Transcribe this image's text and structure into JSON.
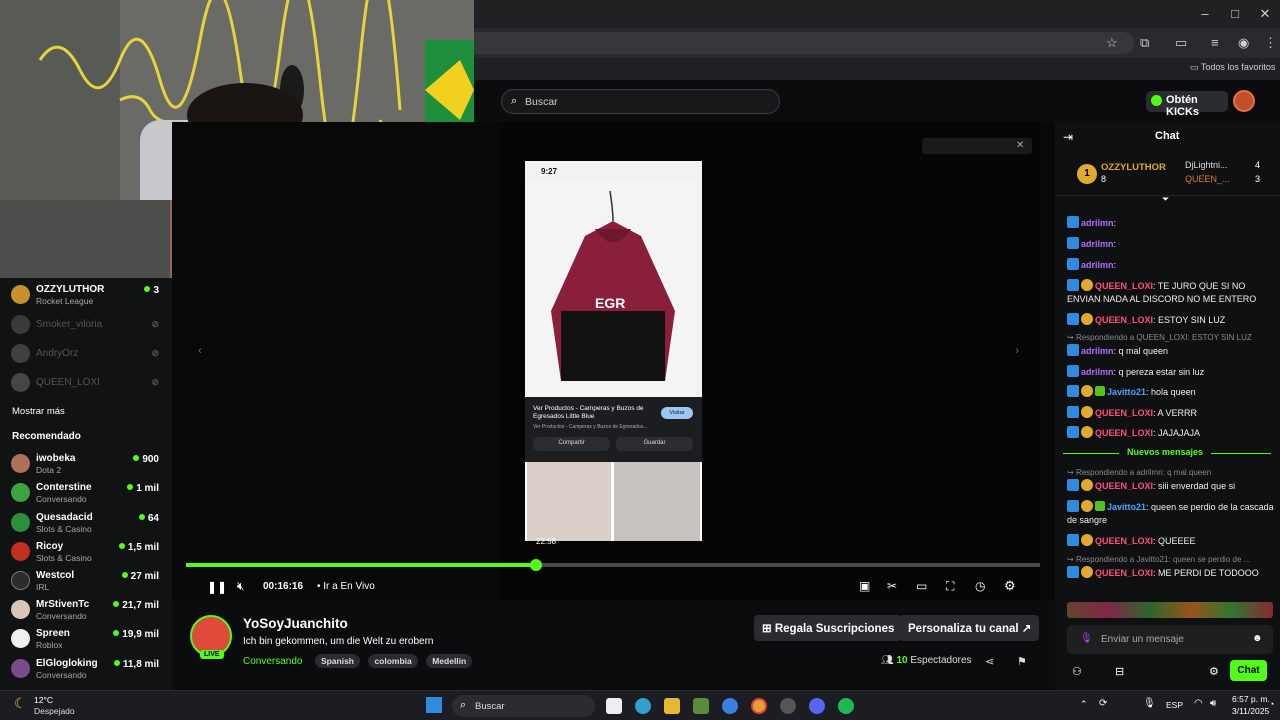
{
  "browser": {
    "bookmarks_all": "Todos los favoritos"
  },
  "header": {
    "search_placeholder": "Buscar",
    "kicks_label": "Obtén KICKs"
  },
  "sidebar": {
    "following": [
      {
        "name": "OZZYLUTHOR",
        "sub": "Rocket League",
        "count": "3",
        "live": true
      },
      {
        "name": "Smoker_viloria",
        "live": false
      },
      {
        "name": "AndryOrz",
        "live": false
      },
      {
        "name": "QUEEN_LOXI",
        "live": false
      }
    ],
    "show_more": "Mostrar más",
    "recommended_title": "Recomendado",
    "recommended": [
      {
        "name": "iwobeka",
        "sub": "Dota 2",
        "count": "900"
      },
      {
        "name": "Conterstine",
        "sub": "Conversando",
        "count": "1 mil"
      },
      {
        "name": "Quesadacid",
        "sub": "Slots & Casino",
        "count": "64"
      },
      {
        "name": "Ricoy",
        "sub": "Slots & Casino",
        "count": "1,5 mil"
      },
      {
        "name": "Westcol",
        "sub": "IRL",
        "count": "27 mil"
      },
      {
        "name": "MrStivenTc",
        "sub": "Conversando",
        "count": "21,7 mil"
      },
      {
        "name": "Spreen",
        "sub": "Roblox",
        "count": "19,9 mil"
      },
      {
        "name": "ElGlogloking",
        "sub": "Conversando",
        "count": "11,8 mil"
      }
    ]
  },
  "video": {
    "phone_time": "9:27",
    "product_title": "Ver Productos - Camperas y Buzos de Egresados Little Blue",
    "product_sub": "Ver Productos - Camperas y Buzos de Egresados...",
    "visit_label": "Visitar",
    "share_label": "Compartir",
    "save_label": "Guardar",
    "hoodie_text": "EGR",
    "preview_time": "22:58",
    "progress": 0.41,
    "elapsed": "00:16:16",
    "go_live": "Ir a En Vivo",
    "inner_search": "Buscar"
  },
  "stream": {
    "channel": "YoSoyJuanchito",
    "title": "Ich bin gekommen, um die Welt zu erobern",
    "category": "Conversando",
    "live_badge": "LIVE",
    "tags": [
      "Spanish",
      "colombia",
      "Medellin"
    ],
    "gift_subs": "Regala Suscripciones",
    "customize": "Personaliza tu canal",
    "viewers_count": "10",
    "viewers_label": "Espectadores"
  },
  "chat": {
    "title": "Chat",
    "top_gifters": [
      {
        "name": "OZZYLUTHOR",
        "count": "8"
      },
      {
        "name": "DjLightni...",
        "count": "4"
      },
      {
        "name": "QUEEN_...",
        "count": "3"
      }
    ],
    "messages": [
      {
        "user": "adrilmn",
        "color": "#b06cff",
        "text": ""
      },
      {
        "user": "adrilmn",
        "color": "#b06cff",
        "text": ""
      },
      {
        "user": "adrilmn",
        "color": "#b06cff",
        "text": ""
      },
      {
        "user": "QUEEN_LOXI",
        "color": "#ff4d7a",
        "text": "TE JURO QUE SI NO ENVIAN NADA AL DISCORD NO ME ENTERO"
      },
      {
        "user": "QUEEN_LOXI",
        "color": "#ff4d7a",
        "text": "ESTOY SIN LUZ"
      },
      {
        "reply": "Respondiendo a QUEEN_LOXI: ESTOY SIN LUZ"
      },
      {
        "user": "adrilmn",
        "color": "#b06cff",
        "text": "q mal queen"
      },
      {
        "user": "adrilmn",
        "color": "#b06cff",
        "text": "q pereza estar sin luz"
      },
      {
        "user": "Javitto21",
        "color": "#4aa3ff",
        "text": "hola queen"
      },
      {
        "user": "QUEEN_LOXI",
        "color": "#ff4d7a",
        "text": "A VERRR"
      },
      {
        "user": "QUEEN_LOXI",
        "color": "#ff4d7a",
        "text": "JAJAJAJA"
      }
    ],
    "new_messages": "Nuevos mensajes",
    "messages_after": [
      {
        "reply": "Respondiendo a adrilmn: q mal queen"
      },
      {
        "user": "QUEEN_LOXI",
        "color": "#ff4d7a",
        "text": "siii enverdad que si"
      },
      {
        "user": "Javitto21",
        "color": "#4aa3ff",
        "text": "queen se perdio de la cascada de sangre"
      },
      {
        "user": "QUEEN_LOXI",
        "color": "#ff4d7a",
        "text": "QUEEEE"
      },
      {
        "reply": "Respondiendo a Javitto21: queen se perdio de ..."
      },
      {
        "user": "QUEEN_LOXI",
        "color": "#ff4d7a",
        "text": "ME PERDI DE TODOOO"
      }
    ],
    "input_placeholder": "Enviar un mensaje",
    "send_label": "Chat"
  },
  "taskbar": {
    "weather_temp": "12°C",
    "weather_desc": "Despejado",
    "search": "Buscar",
    "lang": "ESP",
    "time": "6:57 p. m.",
    "date": "3/11/2025"
  },
  "colors": {
    "accent": "#53fc18",
    "background": "#0b0c0d"
  }
}
